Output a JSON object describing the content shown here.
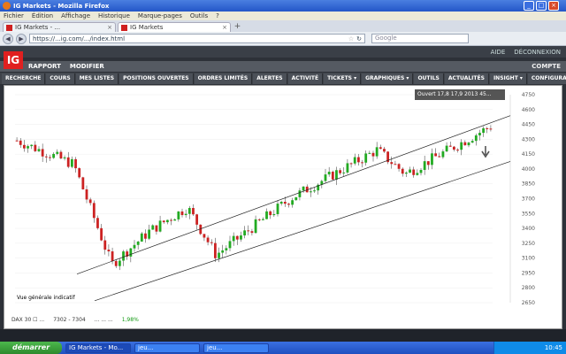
{
  "window": {
    "title": "IG Markets - Mozilla Firefox",
    "min": "_",
    "max": "□",
    "close": "×"
  },
  "menubar": [
    "Fichier",
    "Édition",
    "Affichage",
    "Historique",
    "Marque-pages",
    "Outils",
    "?"
  ],
  "tabs": [
    {
      "label": "IG Markets - ...",
      "close": "×"
    },
    {
      "label": "IG Markets",
      "close": "×"
    }
  ],
  "addtab": "+",
  "nav": {
    "back": "◀",
    "forward": "▶",
    "url": "https://...ig.com/.../index.html",
    "star": "☆",
    "reload": "↻",
    "search_placeholder": "Google"
  },
  "ig": {
    "logo": "IG",
    "top_links": [
      "AIDE",
      "DÉCONNEXION"
    ],
    "toprow": [
      "RAPPORT",
      "MODIFIER"
    ],
    "account": "COMPTE",
    "mainnav": [
      "RECHERCHE",
      "COURS",
      "MES LISTES",
      "POSITIONS OUVERTES",
      "ORDRES LIMITÉS",
      "ALERTES",
      "ACTIVITÉ",
      "TICKETS ▾",
      "GRAPHIQUES ▾",
      "OUTILS",
      "ACTUALITÉS",
      "INSIGHT ▾",
      "CONFIGURATION ▾"
    ]
  },
  "chart_header": {
    "tooltip": "Ouvert 17,8  17,9  2013  45..."
  },
  "annotation": "Vue générale indicatif",
  "infobar": {
    "left": "DAX 30  ☐ ...",
    "values": "7302 - 7304",
    "more": "... ... ...",
    "green": "1,98%"
  },
  "chart_data": {
    "type": "candlestick",
    "y_ticks": [
      "4750",
      "4600",
      "4450",
      "4300",
      "4150",
      "4000",
      "3850",
      "3700",
      "3550",
      "3400",
      "3250",
      "3100",
      "2950",
      "2800",
      "2650"
    ],
    "ylim": [
      2600,
      4780
    ],
    "up_color": "#22aa22",
    "down_color": "#cc2222",
    "n": 130
  },
  "taskbar": {
    "start": "démarrer",
    "items": [
      "IG Markets - Mo...",
      "jeu...",
      "jeu..."
    ],
    "clock": "10:45"
  }
}
